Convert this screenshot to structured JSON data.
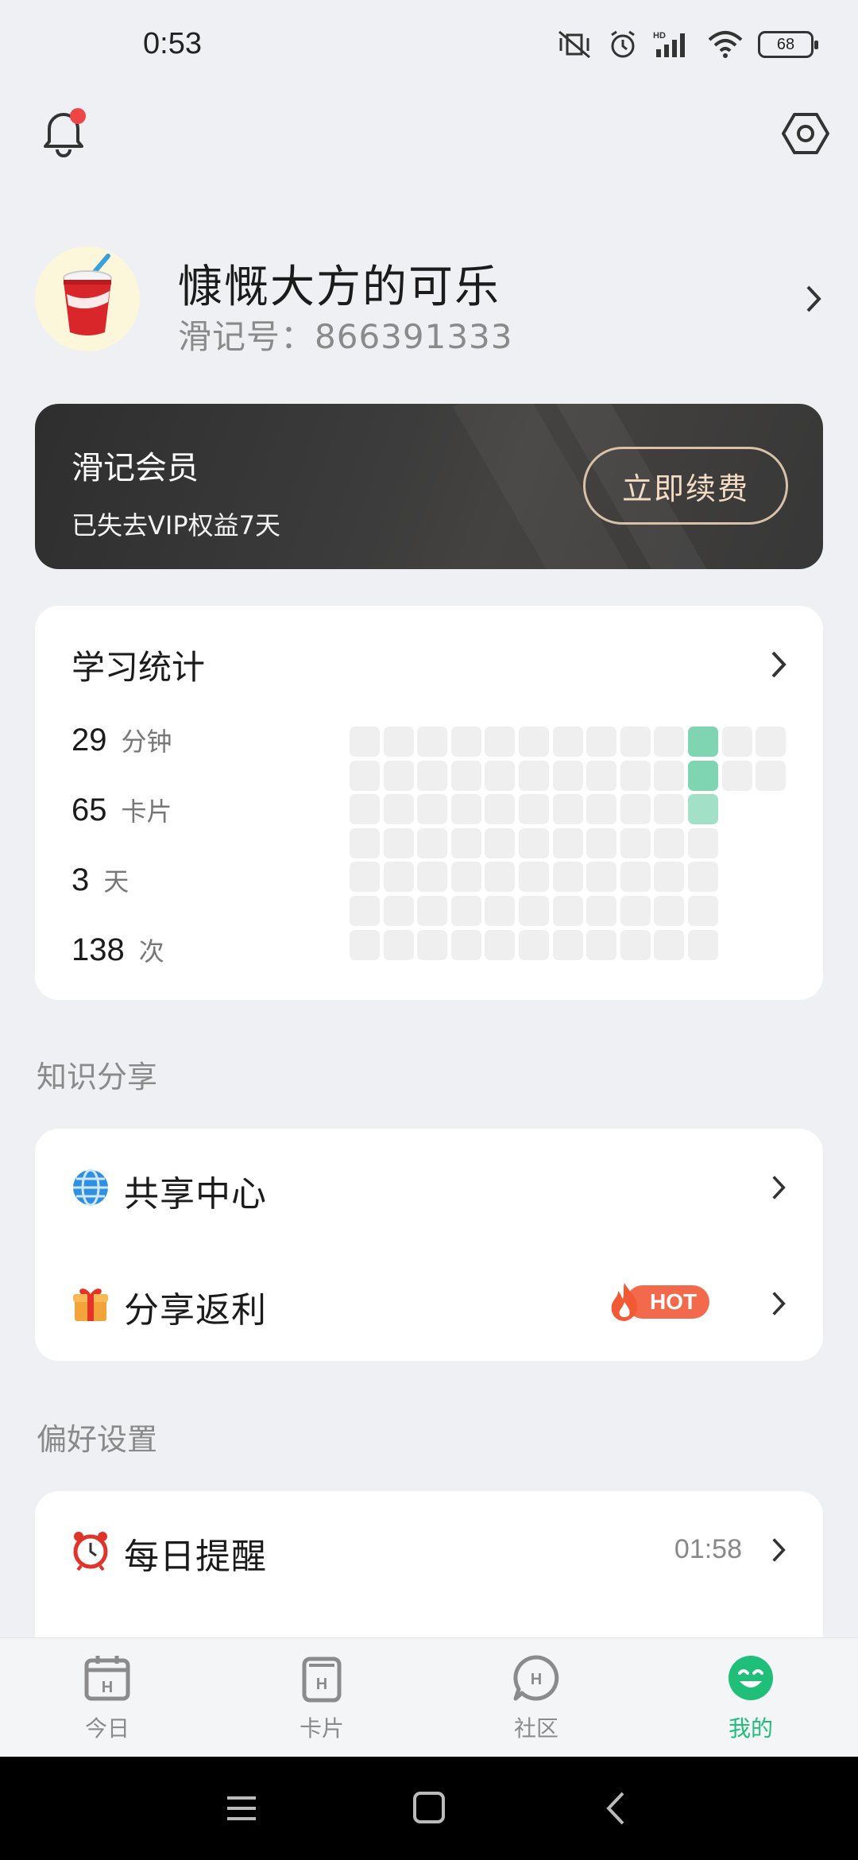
{
  "status_bar": {
    "time": "0:53",
    "battery": "68"
  },
  "profile": {
    "nickname": "慷慨大方的可乐",
    "account_id": "滑记号：866391333"
  },
  "vip": {
    "title": "滑记会员",
    "subtitle": "已失去VIP权益7天",
    "renew_label": "立即续费"
  },
  "stats": {
    "title": "学习统计",
    "rows": [
      {
        "value": "29",
        "unit": "分钟"
      },
      {
        "value": "65",
        "unit": "卡片"
      },
      {
        "value": "3",
        "unit": "天"
      },
      {
        "value": "138",
        "unit": "次"
      }
    ],
    "heatmap_colors": {
      "empty": "#efefef",
      "active": "#7fd4b2",
      "light": "#a3e0c8"
    }
  },
  "knowledge_section": {
    "title": "知识分享",
    "items": [
      {
        "label": "共享中心",
        "icon": "globe-icon"
      },
      {
        "label": "分享返利",
        "icon": "gift-icon",
        "badge": "HOT"
      }
    ]
  },
  "preferences_section": {
    "title": "偏好设置",
    "items": [
      {
        "label": "每日提醒",
        "icon": "alarm-clock-icon",
        "value": "01:58"
      }
    ]
  },
  "bottom_nav": {
    "items": [
      {
        "label": "今日",
        "icon": "calendar-icon",
        "active": false
      },
      {
        "label": "卡片",
        "icon": "card-icon",
        "active": false
      },
      {
        "label": "社区",
        "icon": "community-icon",
        "active": false
      },
      {
        "label": "我的",
        "icon": "smile-icon",
        "active": true
      }
    ],
    "active_color": "#1fbf7a"
  }
}
